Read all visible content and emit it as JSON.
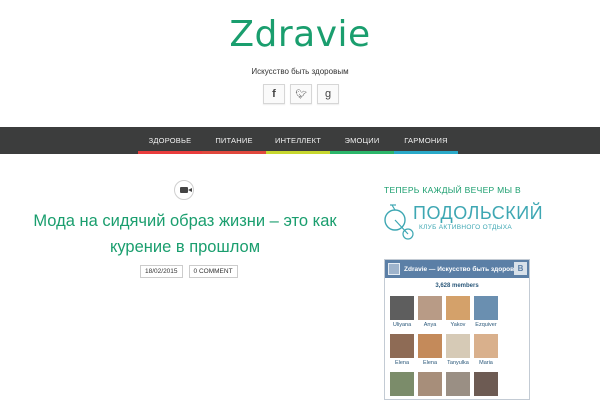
{
  "site": {
    "title": "Zdravie",
    "tagline": "Искусство быть здоровым"
  },
  "social": [
    {
      "glyph": "f",
      "icon": "facebook-icon"
    },
    {
      "glyph": "🐦",
      "icon": "twitter-icon"
    },
    {
      "glyph": "g",
      "icon": "google-plus-icon"
    }
  ],
  "nav": {
    "items": [
      {
        "label": "ЗДОРОВЬЕ",
        "color": "#e93d3d"
      },
      {
        "label": "ПИТАНИЕ",
        "color": "#e0483d"
      },
      {
        "label": "ИНТЕЛЛЕКТ",
        "color": "#c7d72f"
      },
      {
        "label": "ЭМОЦИИ",
        "color": "#2bb66a"
      },
      {
        "label": "ГАРМОНИЯ",
        "color": "#2aa9c8"
      }
    ]
  },
  "post": {
    "format_icon": "video-camera-icon",
    "title": "Мода на сидячий образ жизни – это как курение в прошлом",
    "date": "18/02/2015",
    "comments": "0 COMMENT"
  },
  "sidebar": {
    "promo_text": "ТЕПЕРЬ КАЖДЫЙ ВЕЧЕР МЫ В",
    "club_name": "ПОДОЛЬСКИЙ",
    "club_subtitle": "КЛУБ АКТИВНОГО ОТДЫХА",
    "vk": {
      "logo": "В",
      "title": "Zdravie — Искусство быть здоровым",
      "members_count": "3,628 members",
      "members": [
        {
          "name": "Uliyana",
          "color": "#5e5e5e"
        },
        {
          "name": "Anya",
          "color": "#b89b86"
        },
        {
          "name": "Yakov",
          "color": "#d4a16a"
        },
        {
          "name": "Ezquiver",
          "color": "#6a8fb0"
        },
        {
          "name": "",
          "color": "#ffffff"
        },
        {
          "name": "Elena",
          "color": "#8e6b55"
        },
        {
          "name": "Elena",
          "color": "#c48a5a"
        },
        {
          "name": "Tanyulka",
          "color": "#d6cab6"
        },
        {
          "name": "Maria",
          "color": "#d9b08c"
        },
        {
          "name": "",
          "color": "#ffffff"
        },
        {
          "name": "",
          "color": "#7b8c6a"
        },
        {
          "name": "",
          "color": "#a78e7a"
        },
        {
          "name": "",
          "color": "#9a8f84"
        },
        {
          "name": "",
          "color": "#6d5b53"
        },
        {
          "name": "",
          "color": "#ffffff"
        }
      ]
    }
  }
}
